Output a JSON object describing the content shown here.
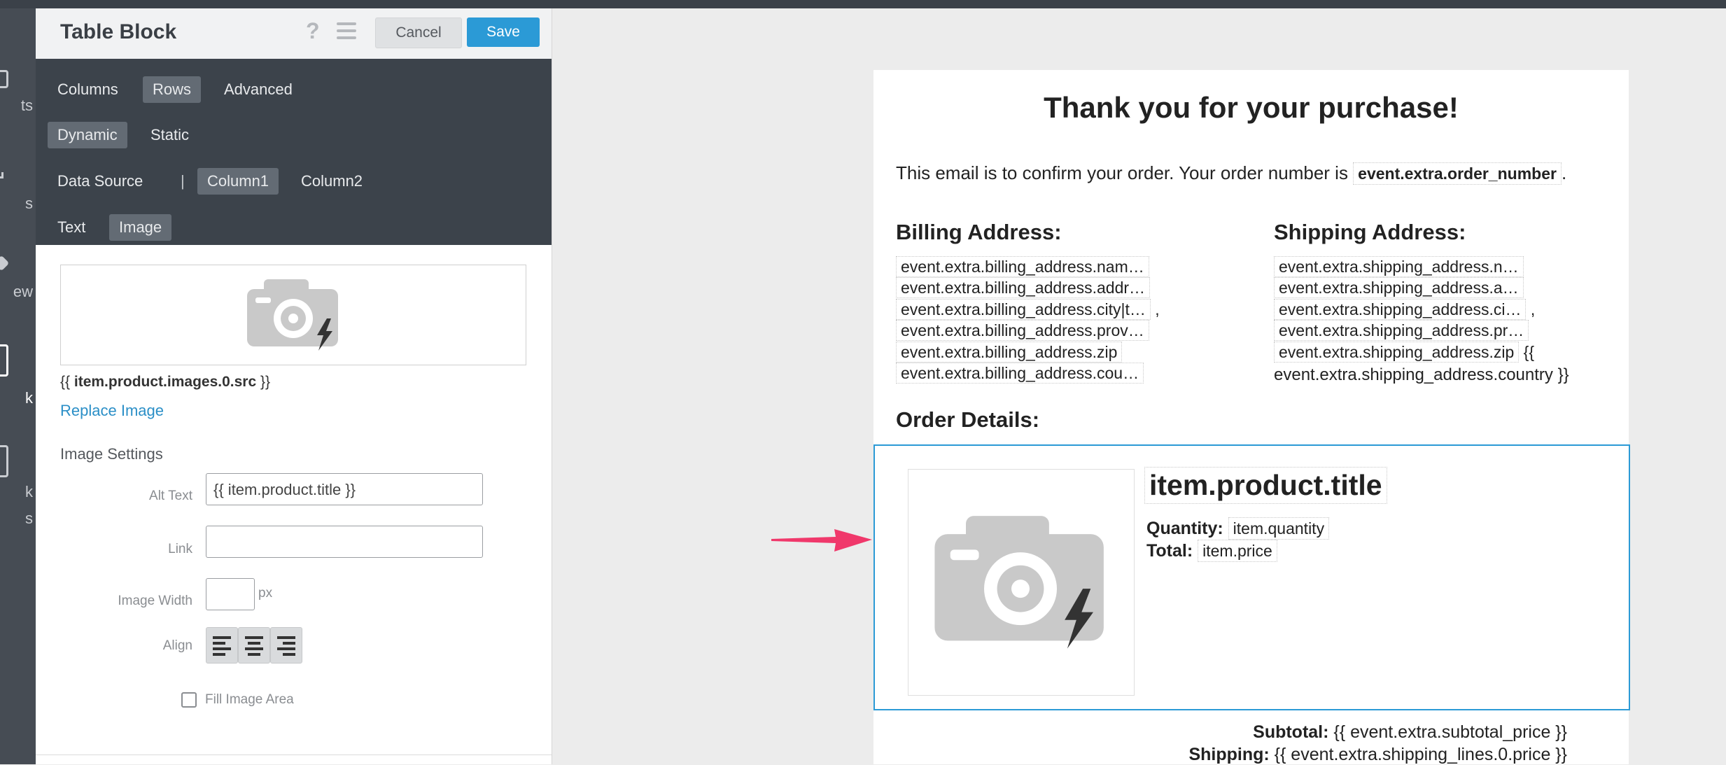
{
  "left_nav": {
    "items": [
      {
        "label": "ts"
      },
      {
        "label": "s"
      },
      {
        "label": "ew"
      },
      {
        "label": "k"
      },
      {
        "label": "k"
      },
      {
        "label": "s"
      }
    ]
  },
  "panel": {
    "title": "Table Block",
    "help_icon": "?",
    "cancel_label": "Cancel",
    "save_label": "Save",
    "tabs_main": [
      "Columns",
      "Rows",
      "Advanced"
    ],
    "tabs_main_active": "Rows",
    "tabs_mode": [
      "Dynamic",
      "Static"
    ],
    "tabs_mode_active": "Dynamic",
    "data_source_label": "Data Source",
    "separator": "|",
    "tabs_column": [
      "Column1",
      "Column2"
    ],
    "tabs_column_active": "Column1",
    "tabs_content": [
      "Text",
      "Image"
    ],
    "tabs_content_active": "Image",
    "image_src_prefix": "{{",
    "image_src_value": "item.product.images.0.src",
    "image_src_suffix": "}}",
    "replace_image_link": "Replace Image",
    "image_settings_heading": "Image Settings",
    "alt_text_label": "Alt Text",
    "alt_text_value": "{{ item.product.title }}",
    "link_label": "Link",
    "link_value": "",
    "image_width_label": "Image Width",
    "image_width_value": "",
    "image_width_unit": "px",
    "align_label": "Align",
    "fill_image_area_label": "Fill Image Area",
    "fill_image_area_checked": false
  },
  "email": {
    "title": "Thank you for your purchase!",
    "confirm_text": "This email is to confirm your order. Your order number is",
    "order_number_token": "event.extra.order_number",
    "confirm_suffix": ".",
    "billing_heading": "Billing Address:",
    "shipping_heading": "Shipping Address:",
    "billing_lines": [
      "event.extra.billing_address.nam…",
      "event.extra.billing_address.addr…",
      "event.extra.billing_address.city|t…",
      "event.extra.billing_address.prov…",
      "event.extra.billing_address.zip",
      "event.extra.billing_address.cou…"
    ],
    "billing_comma": ",",
    "shipping_lines": [
      "event.extra.shipping_address.n…",
      "event.extra.shipping_address.a…",
      "event.extra.shipping_address.ci…",
      "event.extra.shipping_address.pr…",
      "event.extra.shipping_address.zip"
    ],
    "shipping_comma": ",",
    "shipping_zip_suffix": "{{",
    "shipping_country_line": "event.extra.shipping_address.country }}",
    "order_details_heading": "Order Details:",
    "item_title": "item.product.title",
    "quantity_label": "Quantity:",
    "quantity_value": "item.quantity",
    "total_label": "Total:",
    "total_value": "item.price",
    "subtotal_label": "Subtotal:",
    "subtotal_value": "{{ event.extra.subtotal_price }}",
    "shipping_label": "Shipping:",
    "shipping_value": "{{ event.extra.shipping_lines.0.price }}"
  },
  "colors": {
    "accent": "#2b9ad6",
    "arrow": "#f0386b",
    "dark_panel": "#3c434b"
  },
  "icons": {
    "camera_placeholder": "camera-placeholder-icon",
    "lightning": "lightning-icon",
    "annotation_arrow": "pink-arrow-icon"
  }
}
